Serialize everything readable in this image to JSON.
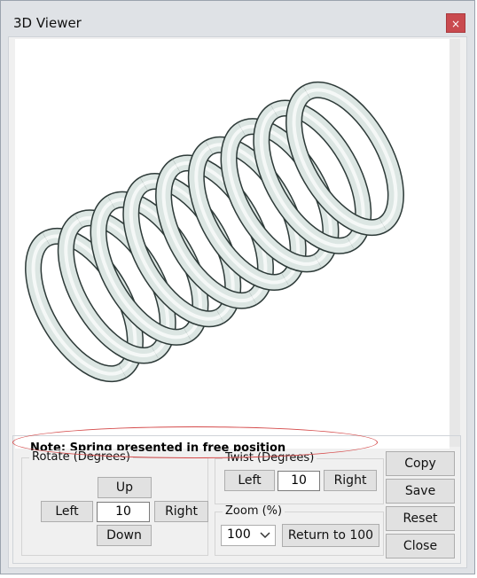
{
  "window": {
    "title": "3D Viewer",
    "close_glyph": "×"
  },
  "note": "Note: Spring presented in free position",
  "rotate": {
    "legend": "Rotate (Degrees)",
    "up": "Up",
    "left": "Left",
    "value": "10",
    "right": "Right",
    "down": "Down"
  },
  "twist": {
    "legend": "Twist (Degrees)",
    "left": "Left",
    "value": "10",
    "right": "Right"
  },
  "zoom": {
    "legend": "Zoom (%)",
    "selected": "100",
    "return": "Return to 100"
  },
  "actions": {
    "copy": "Copy",
    "save": "Save",
    "reset": "Reset",
    "close": "Close"
  },
  "colors": {
    "close_button": "#c94a4f",
    "annotation": "#d54b4b",
    "spring_fill": "#dce6e3",
    "spring_stroke": "#2d3a38"
  },
  "icons": {
    "close": "close-icon",
    "dropdown": "chevron-down-icon"
  }
}
